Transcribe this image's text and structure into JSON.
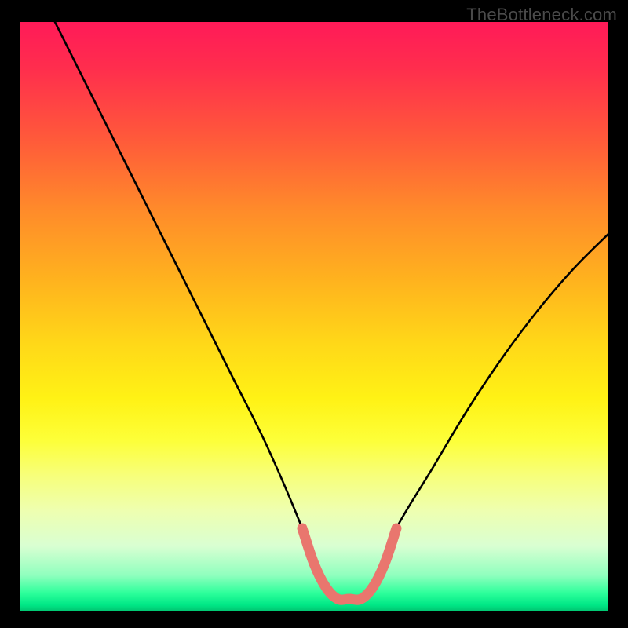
{
  "watermark": "TheBottleneck.com",
  "chart_data": {
    "type": "line",
    "title": "",
    "xlabel": "",
    "ylabel": "",
    "xlim": [
      0,
      100
    ],
    "ylim": [
      0,
      100
    ],
    "series": [
      {
        "name": "bottleneck-curve",
        "x": [
          6,
          12,
          18,
          24,
          30,
          36,
          42,
          48,
          50,
          52,
          54,
          56,
          58,
          60,
          62,
          64,
          70,
          76,
          82,
          88,
          94,
          100
        ],
        "y": [
          100,
          88,
          76,
          64,
          52,
          40,
          28,
          14,
          8,
          4,
          2,
          2,
          2,
          4,
          8,
          14,
          24,
          34,
          43,
          51,
          58,
          64
        ]
      }
    ],
    "highlight": {
      "name": "optimal-zone",
      "x": [
        48,
        50,
        52,
        54,
        56,
        58,
        60,
        62,
        64
      ],
      "y": [
        14,
        8,
        4,
        2,
        2,
        2,
        4,
        8,
        14
      ],
      "color": "#e9766e"
    },
    "annotations": []
  }
}
